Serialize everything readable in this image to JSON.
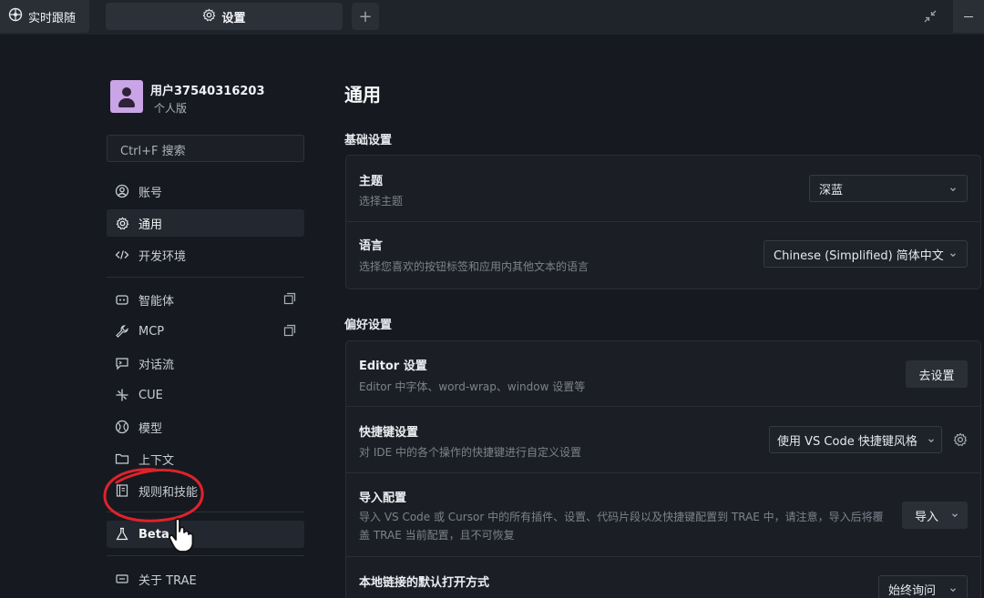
{
  "tabs": {
    "follow_label": "实时跟随",
    "settings_label": "设置",
    "add_label": "+"
  },
  "user": {
    "name": "用户37540316203",
    "plan": "个人版"
  },
  "search": {
    "label": "Ctrl+F 搜索"
  },
  "sidebar": {
    "items": [
      {
        "label": "账号",
        "icon": "user-circle-icon"
      },
      {
        "label": "通用",
        "icon": "gear-icon"
      },
      {
        "label": "开发环境",
        "icon": "code-icon"
      },
      {
        "label": "智能体",
        "icon": "robot-icon"
      },
      {
        "label": "MCP",
        "icon": "wrench-icon"
      },
      {
        "label": "对话流",
        "icon": "chat-icon"
      },
      {
        "label": "CUE",
        "icon": "spark-icon"
      },
      {
        "label": "模型",
        "icon": "model-icon"
      },
      {
        "label": "上下文",
        "icon": "folder-icon"
      },
      {
        "label": "规则和技能",
        "icon": "book-icon"
      },
      {
        "label": "Beta",
        "icon": "flask-icon"
      },
      {
        "label": "关于 TRAE",
        "icon": "info-icon"
      }
    ]
  },
  "main": {
    "title": "通用",
    "basic": {
      "section_title": "基础设置",
      "theme_title": "主题",
      "theme_desc": "选择主题",
      "theme_value": "深蓝",
      "lang_title": "语言",
      "lang_desc": "选择您喜欢的按钮标签和应用内其他文本的语言",
      "lang_value": "Chinese (Simplified) 简体中文"
    },
    "prefs": {
      "section_title": "偏好设置",
      "editor_title": "Editor 设置",
      "editor_desc": "Editor 中字体、word-wrap、window 设置等",
      "editor_button": "去设置",
      "shortcut_title": "快捷键设置",
      "shortcut_desc": "对 IDE 中的各个操作的快捷键进行自定义设置",
      "shortcut_value": "使用 VS Code 快捷键风格",
      "import_title": "导入配置",
      "import_desc": "导入 VS Code 或 Cursor 中的所有插件、设置、代码片段以及快捷键配置到 TRAE 中，请注意，导入后将覆盖 TRAE 当前配置，且不可恢复",
      "import_button": "导入",
      "link_title": "本地链接的默认打开方式",
      "link_value": "始终询问"
    }
  },
  "colors": {
    "background": "#161a20",
    "annotation": "#e0222b"
  }
}
